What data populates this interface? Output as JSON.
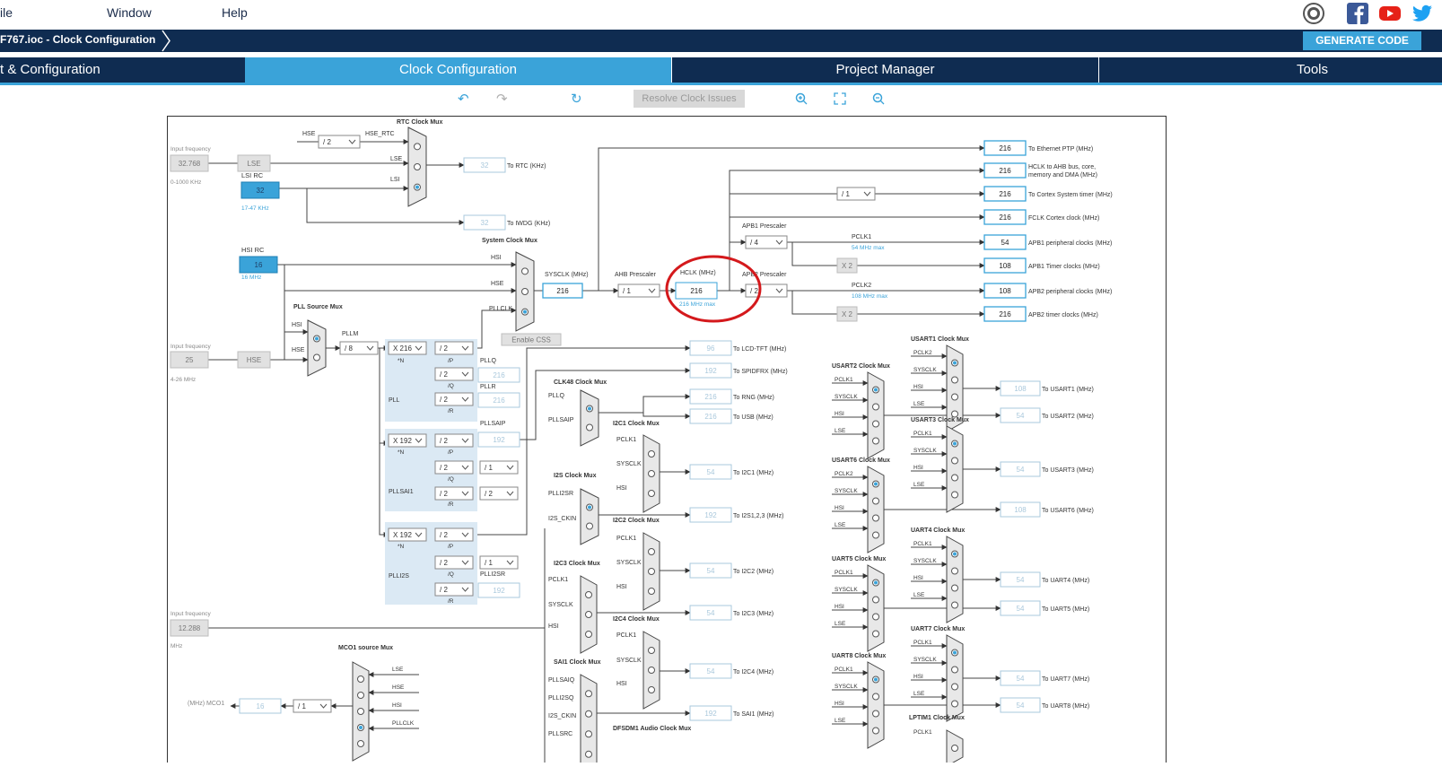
{
  "menu": {
    "file": "ile",
    "window": "Window",
    "help": "Help"
  },
  "breadcrumb": {
    "text": "F767.ioc - Clock Configuration"
  },
  "generate_code": "GENERATE CODE",
  "tabs": [
    {
      "label": "t & Configuration"
    },
    {
      "label": "Clock Configuration"
    },
    {
      "label": "Project Manager"
    },
    {
      "label": "Tools"
    }
  ],
  "toolbar": {
    "resolve_label": "Resolve Clock Issues"
  },
  "colors": {
    "navy": "#0f2c51",
    "accent": "#3aa3d9",
    "highlight": "#d4191c"
  },
  "diagram": {
    "inputs": {
      "lse_freq_label": "Input frequency",
      "lse_freq": "32.768",
      "lse_range": "0-1000 KHz",
      "hse_freq_label": "Input frequency",
      "hse_freq": "25",
      "hse_range": "4-26 MHz",
      "i2s_freq_label": "Input frequency",
      "i2s_freq": "12.288",
      "i2s_unit": "MHz"
    },
    "sources": {
      "lse": "LSE",
      "lsi_rc": "LSI RC",
      "lsi_val": "32",
      "lsi_range": "17-47 KHz",
      "hsi_rc": "HSI RC",
      "hsi_val": "16",
      "hsi_range": "16 MHz",
      "hse": "HSE"
    },
    "rtc": {
      "mux_title": "RTC Clock Mux",
      "hse_label": "HSE",
      "div": "/ 2",
      "hse_rtc": "HSE_RTC",
      "lse": "LSE",
      "lsi": "LSI",
      "out": "32",
      "out_label": "To RTC (KHz)",
      "iwdg": "32",
      "iwdg_label": "To IWDG (KHz)"
    },
    "sysmux": {
      "title": "System Clock Mux",
      "hsi": "HSI",
      "hse": "HSE",
      "pllclk": "PLLCLK",
      "sysclk_label": "SYSCLK (MHz)",
      "sysclk": "216",
      "enable_css": "Enable CSS"
    },
    "ahb": {
      "label": "AHB Prescaler",
      "div": "/ 1"
    },
    "hclk": {
      "label": "HCLK (MHz)",
      "value": "216",
      "max": "216 MHz max"
    },
    "apb1": {
      "label": "APB1 Prescaler",
      "div": "/ 4",
      "pclk": "PCLK1",
      "max": "54 MHz max",
      "x2": "X 2"
    },
    "apb2": {
      "label": "APB2 Prescaler",
      "div": "/ 2",
      "pclk": "PCLK2",
      "max": "108 MHz max",
      "x2": "X 2"
    },
    "cortex_div": "/ 1",
    "outputs": [
      {
        "value": "216",
        "label": "To Ethernet PTP (MHz)"
      },
      {
        "value": "216",
        "label": "HCLK to AHB bus, core,",
        "label2": "memory and DMA (MHz)"
      },
      {
        "value": "216",
        "label": "To Cortex System timer (MHz)"
      },
      {
        "value": "216",
        "label": "FCLK Cortex clock (MHz)"
      },
      {
        "value": "54",
        "label": "APB1 peripheral clocks (MHz)"
      },
      {
        "value": "108",
        "label": "APB1 Timer clocks (MHz)"
      },
      {
        "value": "108",
        "label": "APB2 peripheral clocks (MHz)"
      },
      {
        "value": "216",
        "label": "APB2 timer clocks (MHz)"
      }
    ],
    "pll": {
      "src_title": "PLL Source Mux",
      "hsi": "HSI",
      "hse": "HSE",
      "pllm_label": "PLLM",
      "pllm": "/ 8",
      "n": "X 216",
      "n_lbl": "*N",
      "p": "/ 2",
      "p_lbl": "/P",
      "q": "/ 2",
      "q_lbl": "/Q",
      "r": "/ 2",
      "r_lbl": "/R",
      "pllq": "PLLQ",
      "pllq_val": "216",
      "pllr": "PLLR",
      "pllr_val": "216",
      "name": "PLL"
    },
    "pllsai": {
      "n": "X 192",
      "n_lbl": "*N",
      "p": "/ 2",
      "p_lbl": "/P",
      "q": "/ 2",
      "q_lbl": "/Q",
      "q2": "/ 1",
      "r": "/ 2",
      "r_lbl": "/R",
      "r2": "/ 2",
      "pllsaip": "PLLSAIP",
      "pllsaip_val": "192",
      "name": "PLLSAI1"
    },
    "plli2s": {
      "n": "X 192",
      "n_lbl": "*N",
      "p": "/ 2",
      "p_lbl": "/P",
      "q": "/ 2",
      "q_lbl": "/Q",
      "q2": "/ 1",
      "r": "/ 2",
      "r_lbl": "/R",
      "plli2sr": "PLLI2SR",
      "plli2sr_val": "192",
      "name": "PLLI2S"
    },
    "misc_outs": [
      {
        "value": "96",
        "label": "To LCD-TFT (MHz)"
      },
      {
        "value": "192",
        "label": "To SPIDFRX (MHz)"
      },
      {
        "value": "216",
        "label": "To RNG (MHz)"
      },
      {
        "value": "216",
        "label": "To USB (MHz)"
      },
      {
        "value": "54",
        "label": "To I2C1 (MHz)"
      },
      {
        "value": "192",
        "label": "To I2S1,2,3 (MHz)"
      },
      {
        "value": "54",
        "label": "To I2C2 (MHz)"
      },
      {
        "value": "54",
        "label": "To I2C3 (MHz)"
      },
      {
        "value": "54",
        "label": "To I2C4 (MHz)"
      },
      {
        "value": "192",
        "label": "To SAI1 (MHz)"
      }
    ],
    "muxes": {
      "clk48": "CLK48 Clock Mux",
      "pllq": "PLLQ",
      "pllsaip": "PLLSAIP",
      "i2c1": "I2C1 Clock Mux",
      "i2s": "I2S Clock Mux",
      "plli2sr": "PLLI2SR",
      "i2s_ckin": "I2S_CKIN",
      "i2c2": "I2C2 Clock Mux",
      "i2c3": "I2C3 Clock Mux",
      "i2c4": "I2C4 Clock Mux",
      "sai1": "SAI1 Clock Mux",
      "pllsaiq": "PLLSAIQ",
      "plli2sq": "PLLI2SQ",
      "pllsrc": "PLLSRC",
      "dfsdm": "DFSDM1 Audio Clock Mux",
      "pclk1": "PCLK1",
      "sysclk": "SYSCLK",
      "hsi": "HSI"
    },
    "usart": [
      {
        "title": "USART1 Clock Mux",
        "in1": "PCLK2",
        "value": "108",
        "label": "To USART1 (MHz)"
      },
      {
        "title": "USART2 Clock Mux",
        "in1": "PCLK1",
        "value": "54",
        "label": "To USART2 (MHz)"
      },
      {
        "title": "USART3 Clock Mux",
        "in1": "PCLK1",
        "value": "54",
        "label": "To USART3 (MHz)"
      },
      {
        "title": "USART6 Clock Mux",
        "in1": "PCLK2",
        "value": "108",
        "label": "To USART6 (MHz)"
      },
      {
        "title": "UART4 Clock Mux",
        "in1": "PCLK1",
        "value": "54",
        "label": "To UART4 (MHz)"
      },
      {
        "title": "UART5 Clock Mux",
        "in1": "PCLK1",
        "value": "54",
        "label": "To UART5 (MHz)"
      },
      {
        "title": "UART7 Clock Mux",
        "in1": "PCLK1",
        "value": "54",
        "label": "To UART7 (MHz)"
      },
      {
        "title": "UART8 Clock Mux",
        "in1": "PCLK1",
        "value": "54",
        "label": "To UART8 (MHz)"
      }
    ],
    "usart_inputs": {
      "sysclk": "SYSCLK",
      "hsi": "HSI",
      "lse": "LSE"
    },
    "lptim1": "LPTIM1 Clock Mux",
    "lptim_pclk1": "PCLK1",
    "mco1": {
      "title": "MCO1 source Mux",
      "label": "(MHz) MCO1",
      "value": "16",
      "div": "/ 1",
      "lse": "LSE",
      "hse": "HSE",
      "hsi": "HSI",
      "pllclk": "PLLCLK"
    }
  }
}
